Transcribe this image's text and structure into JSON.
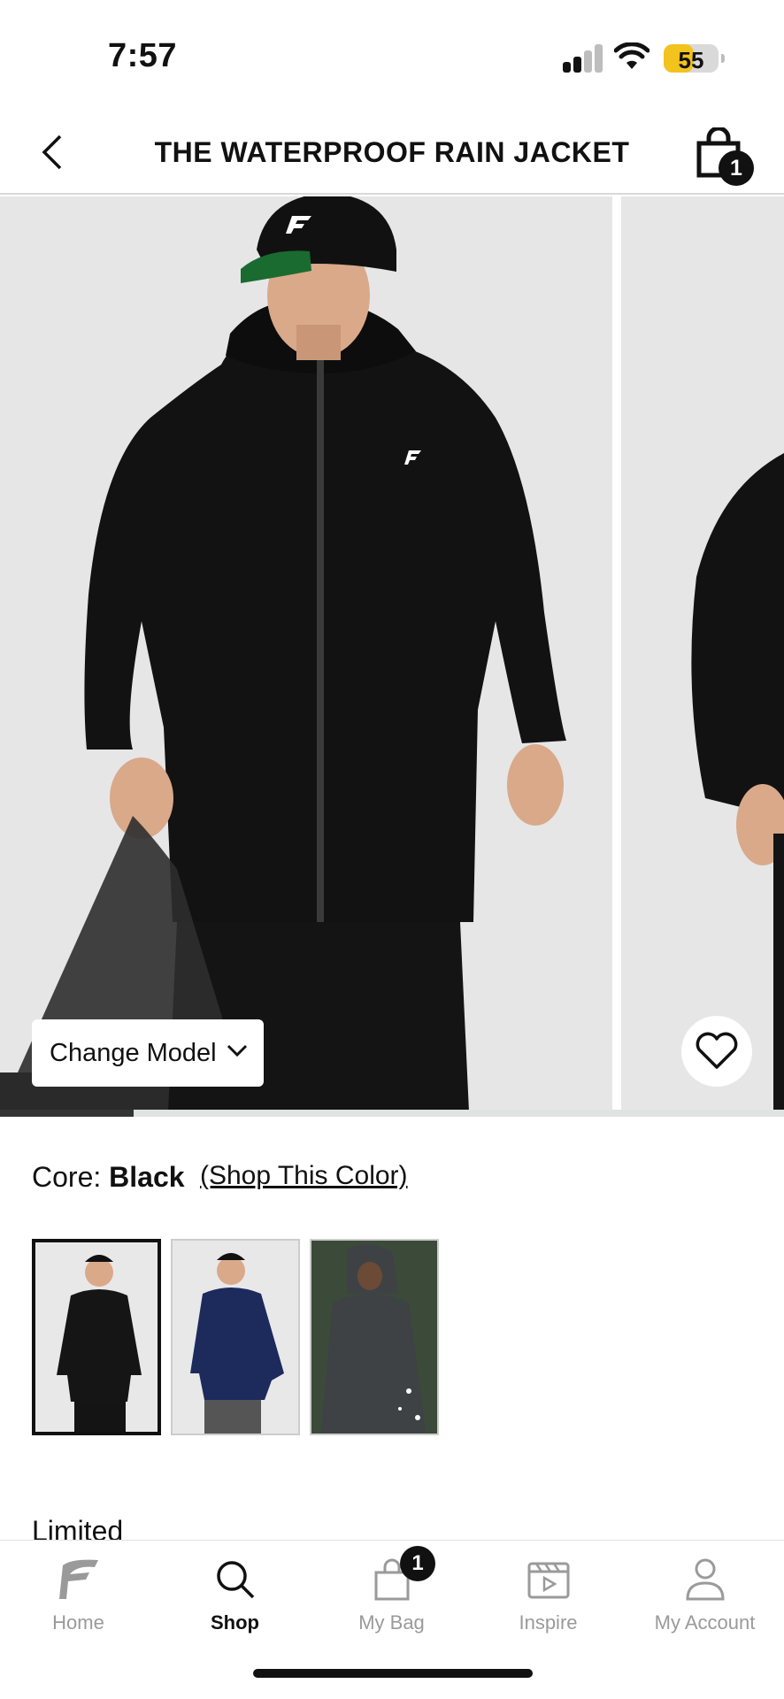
{
  "status_bar": {
    "time": "7:57",
    "battery": "55",
    "battery_level": 0.55
  },
  "header": {
    "title": "THE WATERPROOF RAIN JACKET",
    "bag_count": "1"
  },
  "gallery": {
    "change_model_label": "Change Model",
    "progress": 0.17
  },
  "color": {
    "collection": "Core:",
    "name": "Black",
    "shop_link": "(Shop This Color)"
  },
  "swatches": [
    {
      "name": "Black",
      "color": "#151515",
      "selected": true
    },
    {
      "name": "Navy",
      "color": "#1d2a5c",
      "selected": false
    },
    {
      "name": "Charcoal",
      "color": "#3f4245",
      "selected": false
    }
  ],
  "section_heading": "Limited",
  "tab_bar": {
    "tabs": [
      {
        "label": "Home",
        "icon": "brand-logo-icon"
      },
      {
        "label": "Shop",
        "icon": "search-icon",
        "active": true
      },
      {
        "label": "My Bag",
        "icon": "bag-icon",
        "badge": "1"
      },
      {
        "label": "Inspire",
        "icon": "video-clapper-icon"
      },
      {
        "label": "My Account",
        "icon": "user-icon"
      }
    ]
  }
}
